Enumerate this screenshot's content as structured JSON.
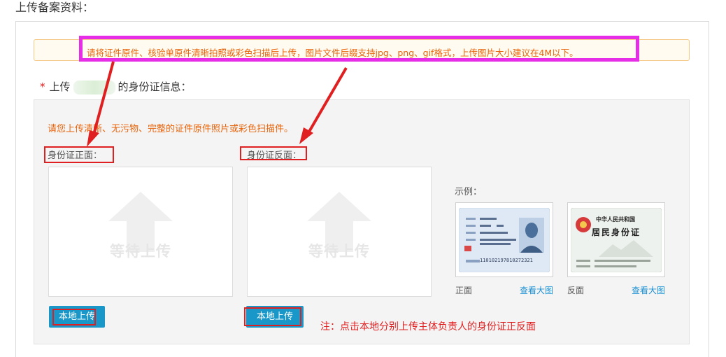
{
  "page": {
    "title": "上传备案资料："
  },
  "notice": {
    "text": "请将证件原件、核验单原件清晰拍照或彩色扫描后上传，图片文件后缀支持jpg、png、gif格式，上传图片大小建议在4M以下。"
  },
  "section": {
    "required_mark": "*",
    "prefix": "上传",
    "suffix": "的身份证信息："
  },
  "upload": {
    "hint": "请您上传清晰、无污物、完整的证件原件照片或彩色扫描件。",
    "front": {
      "caption": "身份证正面：",
      "placeholder": "等待上传",
      "button": "本地上传"
    },
    "back": {
      "caption": "身份证反面：",
      "placeholder": "等待上传",
      "button": "本地上传"
    },
    "note": "注：点击本地分别上传主体负责人的身份证正反面"
  },
  "example": {
    "label": "示例：",
    "front_label": "正面",
    "back_label": "反面",
    "view_large": "查看大图",
    "front_card_number": "110102197810272321",
    "back_card_title_line1": "中华人民共和国",
    "back_card_title_line2": "居民身份证"
  },
  "colors": {
    "accent_blue": "#1897c8",
    "hint_orange": "#e8640a",
    "annotation_red": "#e02020",
    "annotation_magenta": "#e62ee6"
  }
}
